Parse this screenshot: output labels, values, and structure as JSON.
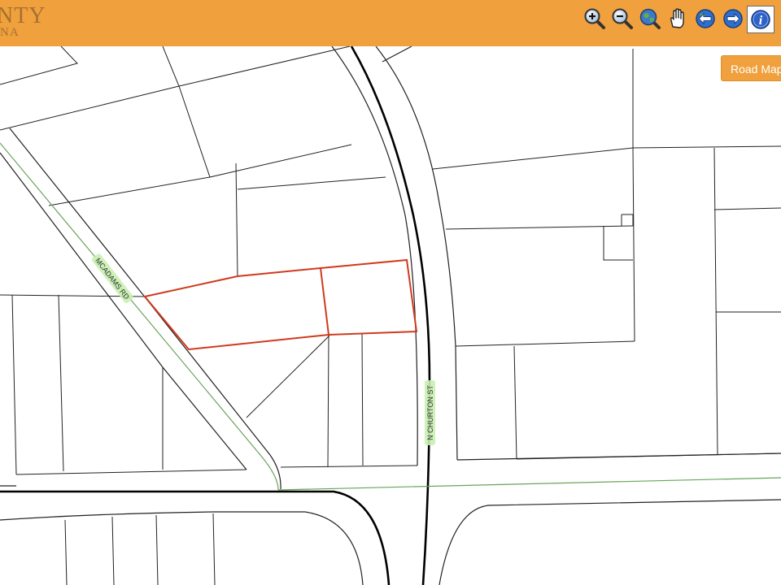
{
  "header": {
    "logo_line1": "NTY",
    "logo_line2": "NA"
  },
  "toolbar": {
    "tools": [
      {
        "name": "zoom-in"
      },
      {
        "name": "zoom-out"
      },
      {
        "name": "full-extent"
      },
      {
        "name": "pan"
      },
      {
        "name": "previous-extent"
      },
      {
        "name": "next-extent"
      },
      {
        "name": "identify",
        "active": true
      }
    ]
  },
  "basemap": {
    "button_label": "Road Map"
  },
  "map": {
    "road_labels": {
      "mcadams": "MCADAMS RD",
      "churton": "N CHURTON ST"
    },
    "colors": {
      "parcel_line": "#222222",
      "selected_parcel": "#d03a1e",
      "road_centerline": "#6aa35a",
      "road_label_halo": "#c8f0b0"
    }
  }
}
